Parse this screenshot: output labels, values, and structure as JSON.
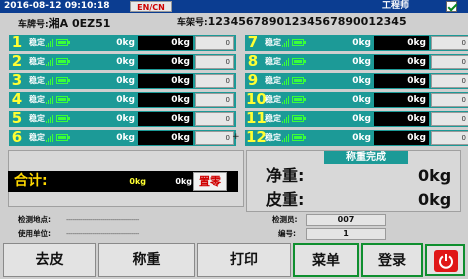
{
  "topbar": {
    "datetime": "2016-08-12  09:10:18",
    "lang": "EN/CN",
    "role": "工程师"
  },
  "vehicle": {
    "plate_label": "车牌号:",
    "plate_value": "湘A 0EZ51",
    "frame_label": "车架号:",
    "frame_value": "12345678901234567890012345"
  },
  "scales_left": [
    {
      "n": "1",
      "status": "稳定",
      "w1": "0kg",
      "w2": "0kg",
      "z": "0"
    },
    {
      "n": "2",
      "status": "稳定",
      "w1": "0kg",
      "w2": "0kg",
      "z": "0"
    },
    {
      "n": "3",
      "status": "稳定",
      "w1": "0kg",
      "w2": "0kg",
      "z": "0"
    },
    {
      "n": "4",
      "status": "稳定",
      "w1": "0kg",
      "w2": "0kg",
      "z": "0"
    },
    {
      "n": "5",
      "status": "稳定",
      "w1": "0kg",
      "w2": "0kg",
      "z": "0"
    },
    {
      "n": "6",
      "status": "稳定",
      "w1": "0kg",
      "w2": "0kg",
      "z": "0"
    }
  ],
  "scales_right": [
    {
      "n": "7",
      "status": "稳定",
      "w1": "0kg",
      "w2": "0kg",
      "z": "0"
    },
    {
      "n": "8",
      "status": "稳定",
      "w1": "0kg",
      "w2": "0kg",
      "z": "0"
    },
    {
      "n": "9",
      "status": "稳定",
      "w1": "0kg",
      "w2": "0kg",
      "z": "0"
    },
    {
      "n": "10",
      "status": "稳定",
      "w1": "0kg",
      "w2": "0kg",
      "z": "0"
    },
    {
      "n": "11",
      "status": "稳定",
      "w1": "0kg",
      "w2": "0kg",
      "z": "0"
    },
    {
      "n": "12",
      "status": "稳定",
      "w1": "0kg",
      "w2": "0kg",
      "z": "0"
    }
  ],
  "separator": "+",
  "total": {
    "label": "合计:",
    "v1": "0kg",
    "v2": "0kg",
    "zero_button": "置零"
  },
  "result": {
    "status": "称重完成",
    "net_label": "净重:",
    "net_value": "0kg",
    "tare_label": "皮重:",
    "tare_value": "0kg"
  },
  "meta": {
    "site_label": "检测地点:",
    "site_value": "------------------------------------",
    "unit_label": "使用单位:",
    "unit_value": "------------------------------------",
    "station_label": "检测员:",
    "station_value": "007",
    "code_label": "编号:",
    "code_value": "1"
  },
  "buttons": {
    "tare": "去皮",
    "weigh": "称重",
    "print": "打印",
    "menu": "菜单",
    "login": "登录"
  },
  "icons": {
    "power": "power-icon",
    "check": "check-icon"
  },
  "colors": {
    "topbar": "#0b3d91",
    "row": "#1c9a97",
    "number": "#ffff33",
    "accent_green": "#0f8f2f",
    "power": "#e01818"
  }
}
